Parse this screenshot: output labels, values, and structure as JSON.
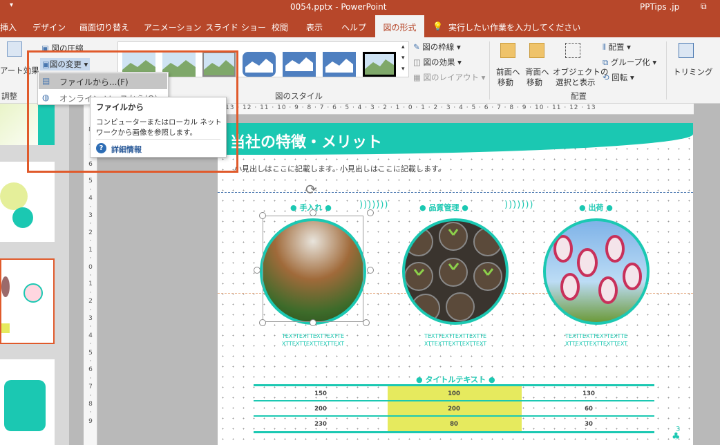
{
  "window": {
    "title": "0054.pptx  -  PowerPoint",
    "brand": "PPTips .jp"
  },
  "tabs": [
    "挿入",
    "デザイン",
    "画面切り替え",
    "アニメーション",
    "スライド ショー",
    "校閲",
    "表示",
    "ヘルプ"
  ],
  "active_tab": "図の形式",
  "tell_me": "実行したい作業を入力してください",
  "ribbon": {
    "compress": "図の圧縮",
    "art_effects": "アート効果",
    "change_picture": "図の変更",
    "adjust": "調整",
    "styles_group": "図のスタイル",
    "border": "図の枠線",
    "effects": "図の効果",
    "layout": "図のレイアウト",
    "forward": "前面へ",
    "forward2": "移動",
    "backward": "背面へ",
    "backward2": "移動",
    "selection": "オブジェクトの",
    "selection2": "選択と表示",
    "align": "配置",
    "group": "グループ化",
    "rotate": "回転",
    "arrange_group": "配置",
    "crop": "トリミング"
  },
  "dropdown": {
    "from_file": "ファイルから...(F)",
    "online": "オンライン ソースから(O)"
  },
  "tooltip": {
    "title": "ファイルから",
    "body1": "コンピューターまたはローカル ネット",
    "body2": "ワークから画像を参照します。",
    "more": "詳細情報"
  },
  "slide": {
    "title": "当社の特徴・メリット",
    "subtitle": "小見出しはここに記載します。小見出しはここに記載します。",
    "items": [
      {
        "label": "手入れ",
        "text1": "TEXTTEXTTEXTTEXTTE",
        "text2": "XTTEXTTEXTTEXTTEXT"
      },
      {
        "label": "品質管理",
        "text1": "TEXTTEXTTEXTTEXTTE",
        "text2": "XTTEXTTEXTTEXTTEXT"
      },
      {
        "label": "出荷",
        "text1": "TEXTTEXTTEXTTEXTTE",
        "text2": "XTTEXTTEXTTEXTTEXT"
      }
    ],
    "table_title": "タイトルテキスト",
    "table": [
      [
        "150",
        "100",
        "130"
      ],
      [
        "200",
        "200",
        "60"
      ],
      [
        "230",
        "80",
        "30"
      ]
    ],
    "page_num": "3"
  },
  "colors": {
    "accent": "#1bc8b2",
    "ppt_red": "#b7472a",
    "highlight": "#e05a2b",
    "cell_yellow": "#e6ea5e"
  }
}
